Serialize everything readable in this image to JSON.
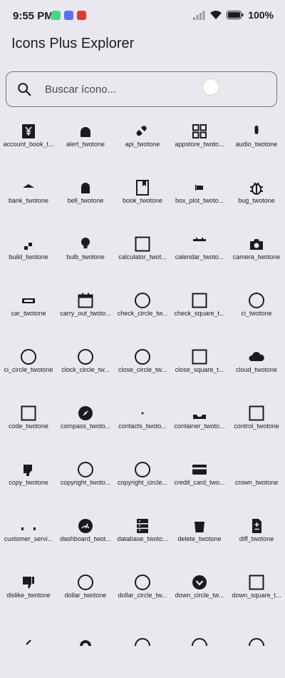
{
  "status_bar": {
    "time": "9:55 PM",
    "battery": "100",
    "app_icon_colors": [
      "#3ddc84",
      "#5b6dff",
      "#e53935"
    ]
  },
  "app": {
    "title": "Icons Plus Explorer"
  },
  "search": {
    "placeholder": "Buscar ícono..."
  },
  "icons": [
    {
      "label": "account_book_t...",
      "glyph": "yen"
    },
    {
      "label": "alert_twotone",
      "glyph": "arch-small"
    },
    {
      "label": "api_twotone",
      "glyph": "pill"
    },
    {
      "label": "appstore_twoto...",
      "glyph": "grid4"
    },
    {
      "label": "audio_twotone",
      "glyph": "capsule-v"
    },
    {
      "label": "bank_twotone",
      "glyph": "tri-up"
    },
    {
      "label": "bell_twotone",
      "glyph": "bell"
    },
    {
      "label": "book_twotone",
      "glyph": "book"
    },
    {
      "label": "box_plot_twoto...",
      "glyph": "boxplot"
    },
    {
      "label": "bug_twotone",
      "glyph": "bug"
    },
    {
      "label": "build_twotone",
      "glyph": "steps"
    },
    {
      "label": "bulb_twotone",
      "glyph": "bulb"
    },
    {
      "label": "calculator_twot...",
      "glyph": "square-outline"
    },
    {
      "label": "calendar_twoto...",
      "glyph": "calendar-top"
    },
    {
      "label": "camera_twotone",
      "glyph": "camera"
    },
    {
      "label": "car_twotone",
      "glyph": "car"
    },
    {
      "label": "carry_out_twoto...",
      "glyph": "calendar"
    },
    {
      "label": "check_circle_tw...",
      "glyph": "circle-outline"
    },
    {
      "label": "check_square_t...",
      "glyph": "square-outline"
    },
    {
      "label": "ci_twotone",
      "glyph": "circle-outline"
    },
    {
      "label": "ci_circle_twotone",
      "glyph": "circle-outline"
    },
    {
      "label": "clock_circle_tw...",
      "glyph": "circle-outline"
    },
    {
      "label": "close_circle_tw...",
      "glyph": "circle-outline"
    },
    {
      "label": "close_square_t...",
      "glyph": "square-outline"
    },
    {
      "label": "cloud_twotone",
      "glyph": "cloud"
    },
    {
      "label": "code_twotone",
      "glyph": "square-outline"
    },
    {
      "label": "compass_twoto...",
      "glyph": "compass"
    },
    {
      "label": "contacts_twoto...",
      "glyph": "dot"
    },
    {
      "label": "container_twoto...",
      "glyph": "tray"
    },
    {
      "label": "control_twotone",
      "glyph": "square-outline"
    },
    {
      "label": "copy_twotone",
      "glyph": "copy"
    },
    {
      "label": "copyright_twoto...",
      "glyph": "circle-outline"
    },
    {
      "label": "copyright_circle...",
      "glyph": "circle-outline"
    },
    {
      "label": "credit_card_two...",
      "glyph": "card"
    },
    {
      "label": "crown_twotone",
      "glyph": "none"
    },
    {
      "label": "customer_servi...",
      "glyph": "dots"
    },
    {
      "label": "dashboard_twot...",
      "glyph": "gauge"
    },
    {
      "label": "database_twoto...",
      "glyph": "database"
    },
    {
      "label": "delete_twotone",
      "glyph": "bin"
    },
    {
      "label": "diff_twotone",
      "glyph": "diff"
    },
    {
      "label": "dislike_twotone",
      "glyph": "dislike"
    },
    {
      "label": "dollar_twotone",
      "glyph": "circle-outline"
    },
    {
      "label": "dollar_circle_tw...",
      "glyph": "circle-outline"
    },
    {
      "label": "down_circle_tw...",
      "glyph": "down-circle"
    },
    {
      "label": "down_square_t...",
      "glyph": "square-outline"
    },
    {
      "label": "",
      "glyph": "partial-caret"
    },
    {
      "label": "",
      "glyph": "partial-pin"
    },
    {
      "label": "",
      "glyph": "partial-circle"
    },
    {
      "label": "",
      "glyph": "partial-circle"
    },
    {
      "label": "",
      "glyph": "partial-circle"
    }
  ]
}
